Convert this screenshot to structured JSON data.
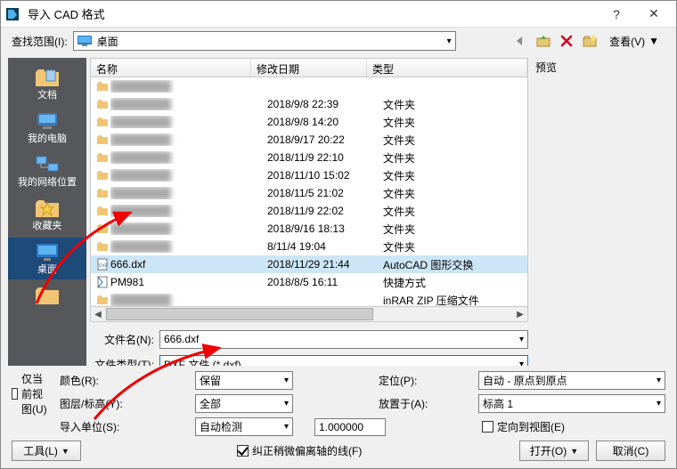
{
  "title": "导入 CAD 格式",
  "lookin_label": "查找范围(I):",
  "lookin_value": "桌面",
  "view_button": "查看(V)",
  "sidebar": {
    "items": [
      {
        "label": "文档"
      },
      {
        "label": "我的电脑"
      },
      {
        "label": "我的网络位置"
      },
      {
        "label": "收藏夹"
      },
      {
        "label": "桌面"
      },
      {
        "label": ""
      }
    ]
  },
  "columns": {
    "name": "名称",
    "date": "修改日期",
    "type": "类型"
  },
  "rows": [
    {
      "name": "",
      "date": "",
      "type": ""
    },
    {
      "name": "",
      "date": "2018/9/8 22:39",
      "type": "文件夹"
    },
    {
      "name": "",
      "date": "2018/9/8 14:20",
      "type": "文件夹"
    },
    {
      "name": "",
      "date": "2018/9/17 20:22",
      "type": "文件夹"
    },
    {
      "name": "",
      "date": "2018/11/9 22:10",
      "type": "文件夹"
    },
    {
      "name": "",
      "date": "2018/11/10 15:02",
      "type": "文件夹"
    },
    {
      "name": "",
      "date": "2018/11/5 21:02",
      "type": "文件夹"
    },
    {
      "name": "",
      "date": "2018/11/9 22:02",
      "type": "文件夹"
    },
    {
      "name": "",
      "date": "2018/9/16 18:13",
      "type": "文件夹"
    },
    {
      "name": "",
      "date": "8/11/4 19:04",
      "type": "文件夹"
    },
    {
      "name": "666.dxf",
      "date": "2018/11/29 21:44",
      "type": "AutoCAD 图形交换"
    },
    {
      "name": "PM981",
      "date": "2018/8/5 16:11",
      "type": "快捷方式"
    },
    {
      "name": "",
      "date": "",
      "type": "inRAR ZIP 压缩文件"
    }
  ],
  "filename_label": "文件名(N):",
  "filename_value": "666.dxf",
  "filetype_label": "文件类型(T):",
  "filetype_value": "DXF 文件 (*.dxf)",
  "preview_label": "预览",
  "current_view_only": "仅当前视图(U)",
  "opts": {
    "color_label": "颜色(R):",
    "color_value": "保留",
    "layer_label": "图层/标高(Y):",
    "layer_value": "全部",
    "unit_label": "导入单位(S):",
    "unit_value": "自动检测",
    "unit_num": "1.000000",
    "pos_label": "定位(P):",
    "pos_value": "自动 - 原点到原点",
    "place_label": "放置于(A):",
    "place_value": "标高 1",
    "orient_label": "定向到视图(E)",
    "axis_label": "纠正稍微偏离轴的线(F)"
  },
  "tools_label": "工具(L)",
  "open_label": "打开(O)",
  "cancel_label": "取消(C)"
}
